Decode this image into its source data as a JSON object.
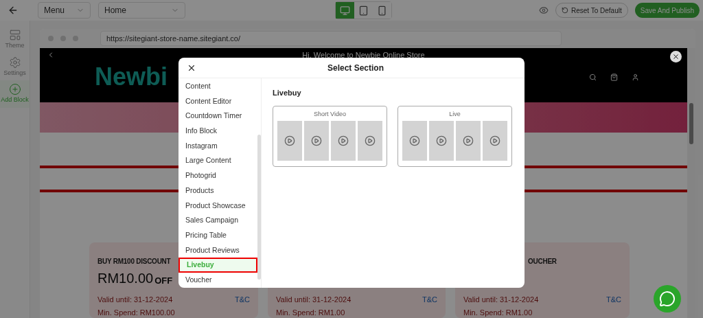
{
  "topbar": {
    "menu_select": "Menu",
    "page_select": "Home",
    "devices": [
      {
        "kind": "desktop",
        "selected": true
      },
      {
        "kind": "tablet",
        "selected": false
      },
      {
        "kind": "mobile",
        "selected": false
      }
    ],
    "reset_button": "Reset To Default",
    "publish_button": "Save And Publish"
  },
  "sidebar": {
    "items": [
      {
        "kind": "theme",
        "label": "Theme",
        "selected": false
      },
      {
        "kind": "settings",
        "label": "Settings",
        "selected": false
      },
      {
        "kind": "add",
        "label": "Add Block",
        "selected": true
      }
    ]
  },
  "browser": {
    "url": "https://sitegiant-store-name.sitegiant.co/"
  },
  "store": {
    "announcement": "Hi, Welcome to Newbie Online Store",
    "logo": "Newbi",
    "vouchers": [
      {
        "title": "BUY RM100 DISCOUNT",
        "amount": "RM10.00",
        "amount_suffix": "OFF",
        "valid": "Valid until: 31-12-2024",
        "min_spend": "Min. Spend: RM100.00",
        "terms": "T&C"
      },
      {
        "valid": "Valid until: 31-12-2024",
        "min_spend": "Min. Spend: RM1.00",
        "terms": "T&C"
      },
      {
        "title": "OUCHER",
        "valid": "Valid until: 31-12-2024",
        "min_spend": "Min. Spend: RM1.00",
        "terms": "T&C"
      }
    ]
  },
  "modal": {
    "title": "Select Section",
    "items": [
      {
        "label": "Content",
        "selected": false
      },
      {
        "label": "Content Editor",
        "selected": false
      },
      {
        "label": "Countdown Timer",
        "selected": false
      },
      {
        "label": "Info Block",
        "selected": false
      },
      {
        "label": "Instagram",
        "selected": false
      },
      {
        "label": "Large Content",
        "selected": false
      },
      {
        "label": "Photogrid",
        "selected": false
      },
      {
        "label": "Products",
        "selected": false
      },
      {
        "label": "Product Showcase",
        "selected": false
      },
      {
        "label": "Sales Campaign",
        "selected": false
      },
      {
        "label": "Pricing Table",
        "selected": false
      },
      {
        "label": "Product Reviews",
        "selected": false
      },
      {
        "label": "Livebuy",
        "selected": true
      },
      {
        "label": "Voucher",
        "selected": false
      }
    ],
    "heading": "Livebuy",
    "layouts": [
      {
        "label": "Short Video"
      },
      {
        "label": "Live"
      }
    ]
  }
}
